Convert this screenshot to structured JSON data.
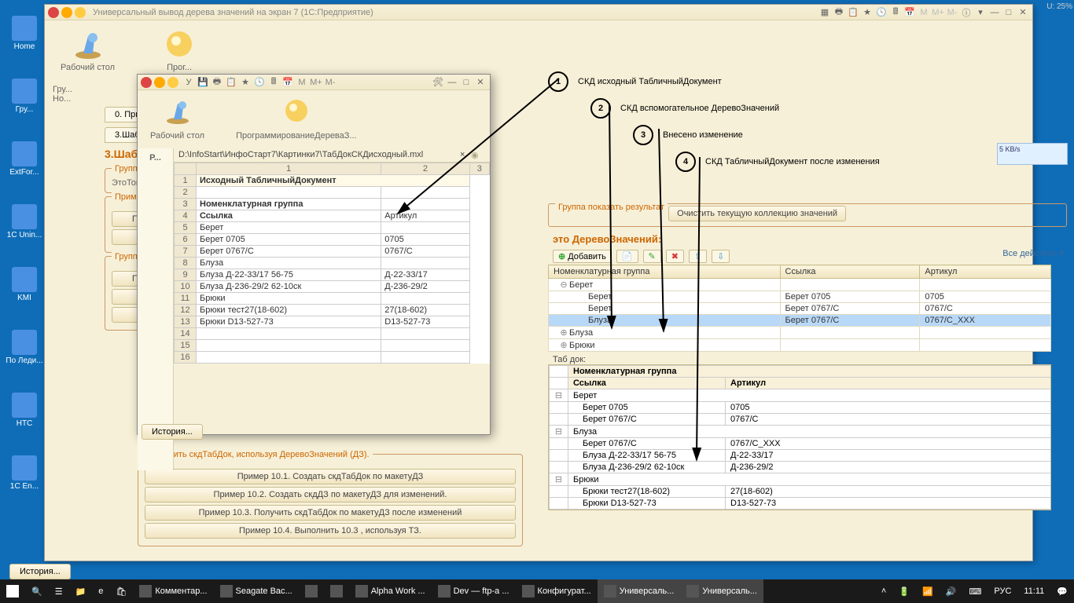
{
  "status_top": "U: 25%",
  "desktop": [
    {
      "label": "Home"
    },
    {
      "label": "Гру..."
    },
    {
      "label": "ExtFor..."
    },
    {
      "label": "1C Unin..."
    },
    {
      "label": "KMI"
    },
    {
      "label": "По Леди..."
    },
    {
      "label": "HTC"
    },
    {
      "label": "1C En..."
    }
  ],
  "main_window": {
    "title": "Универсальный вывод дерева значений на экран 7  (1С:Предприятие)",
    "top_labels": {
      "desk": "Рабочий стол",
      "prog": "Прог..."
    },
    "tabs": [
      "0. Примеры",
      "3.Шаблоны"
    ],
    "section_title": "3.Шабл",
    "group1_title": "Группа при",
    "group2_title": "Примеры",
    "group3_title": "Группа ...",
    "left_buttons_a": [
      "Пример",
      "При"
    ],
    "left_buttons_b": [
      "Пример",
      "При",
      "При"
    ],
    "fs4_title": "Изменить скдТабДок, используя ДеревоЗначений (ДЗ).",
    "fs4_buttons": [
      "Пример 10.1. Создать скдТабДок по макетуДЗ",
      "Пример 10.2. Создать скдДЗ по макетуДЗ для изменений.",
      "Пример 10.3. Получить скдТабДок по макетуДЗ после изменений",
      "Пример 10.4. Выполнить 10.3 , используя ТЗ."
    ]
  },
  "inner_window": {
    "top_labels": {
      "desk": "Рабочий стол",
      "prog": "ПрограммированиеДереваЗ..."
    },
    "sidebar": "Р...",
    "path": "D:\\InfoStart\\ИнфоСтарт7\\Картинки7\\ТабДокСКДисходный.mxl",
    "colhdrs": [
      "",
      "1",
      "2",
      "3"
    ],
    "rows": [
      {
        "n": "1",
        "a": "Исходный  ТабличныйДокумент",
        "b": "",
        "cls": "h1"
      },
      {
        "n": "2",
        "a": "",
        "b": ""
      },
      {
        "n": "3",
        "a": "Номенклатурная группа",
        "b": "",
        "cls": "h2"
      },
      {
        "n": "4",
        "a": "Ссылка",
        "b": "Артикул",
        "cls": "h2"
      },
      {
        "n": "5",
        "a": "Берет",
        "b": ""
      },
      {
        "n": "6",
        "a": "   Берет 0705",
        "b": "0705"
      },
      {
        "n": "7",
        "a": "   Берет 0767/С",
        "b": "0767/С"
      },
      {
        "n": "8",
        "a": "Блуза",
        "b": ""
      },
      {
        "n": "9",
        "a": "   Блуза Д-22-33/17 56-75",
        "b": "Д-22-33/17"
      },
      {
        "n": "10",
        "a": "   Блуза Д-236-29/2 62-10ск",
        "b": "Д-236-29/2"
      },
      {
        "n": "11",
        "a": "Брюки",
        "b": ""
      },
      {
        "n": "12",
        "a": "   Брюки тест27(18-602)",
        "b": "27(18-602)"
      },
      {
        "n": "13",
        "a": "   Брюки  D13-527-73",
        "b": "D13-527-73"
      },
      {
        "n": "14",
        "a": "",
        "b": ""
      },
      {
        "n": "15",
        "a": "",
        "b": ""
      },
      {
        "n": "16",
        "a": "",
        "b": ""
      }
    ],
    "history": "История..."
  },
  "annotations": [
    {
      "n": "1",
      "text": "СКД исходный ТабличныйДокумент"
    },
    {
      "n": "2",
      "text": "СКД вспомогательное ДеревоЗначений"
    },
    {
      "n": "3",
      "text": "Внесено изменение"
    },
    {
      "n": "4",
      "text": "СКД ТабличныйДокумент после изменения"
    }
  ],
  "right": {
    "group_title": "Группа показать результат",
    "clear_btn": "Очистить текущую коллекцию значений",
    "tree_title": "это  ДеревоЗначений:",
    "add_btn": "Добавить",
    "all_actions": "Все действия ▾",
    "tree_cols": [
      "Номенклатурная группа",
      "Ссылка",
      "Артикул"
    ],
    "tree_rows": [
      {
        "exp": "⊖",
        "a": "Берет",
        "b": "",
        "c": "",
        "lvl": 0
      },
      {
        "exp": "",
        "a": "Берет",
        "b": "Берет 0705",
        "c": "0705",
        "lvl": 1
      },
      {
        "exp": "",
        "a": "Берет",
        "b": "Берет 0767/С",
        "c": "0767/С",
        "lvl": 1
      },
      {
        "exp": "",
        "a": "Блуза",
        "b": "Берет 0767/С",
        "c": "0767/С_XXX",
        "lvl": 1,
        "sel": true
      },
      {
        "exp": "⊕",
        "a": "Блуза",
        "b": "",
        "c": "",
        "lvl": 0
      },
      {
        "exp": "⊕",
        "a": "Брюки",
        "b": "",
        "c": "",
        "lvl": 0
      }
    ],
    "tabdok_label": "Таб док:",
    "tabdok_hdr1": "Номенклатурная группа",
    "tabdok_hdr2a": "Ссылка",
    "tabdok_hdr2b": "Артикул",
    "tabdok_rows": [
      {
        "a": "Берет",
        "b": "",
        "grp": true
      },
      {
        "a": "Берет 0705",
        "b": "0705"
      },
      {
        "a": "Берет 0767/С",
        "b": "0767/С"
      },
      {
        "a": "Блуза",
        "b": "",
        "grp": true
      },
      {
        "a": "Берет 0767/С",
        "b": "0767/С_XXX"
      },
      {
        "a": "Блуза Д-22-33/17 56-75",
        "b": "Д-22-33/17"
      },
      {
        "a": "Блуза Д-236-29/2 62-10ск",
        "b": "Д-236-29/2"
      },
      {
        "a": "Брюки",
        "b": "",
        "grp": true
      },
      {
        "a": "Брюки тест27(18-602)",
        "b": "27(18-602)"
      },
      {
        "a": "Брюки  D13-527-73",
        "b": "D13-527-73"
      }
    ]
  },
  "history2": "История...",
  "net_widget": "5 KB/s",
  "taskbar": {
    "items": [
      "Комментар...",
      "Seagate Bac...",
      "",
      "",
      "Alpha Work ...",
      "Dev — ftp-a ...",
      "Конфигурат...",
      "Универсаль...",
      "Универсаль..."
    ],
    "lang": "РУС",
    "time": "11:11"
  }
}
